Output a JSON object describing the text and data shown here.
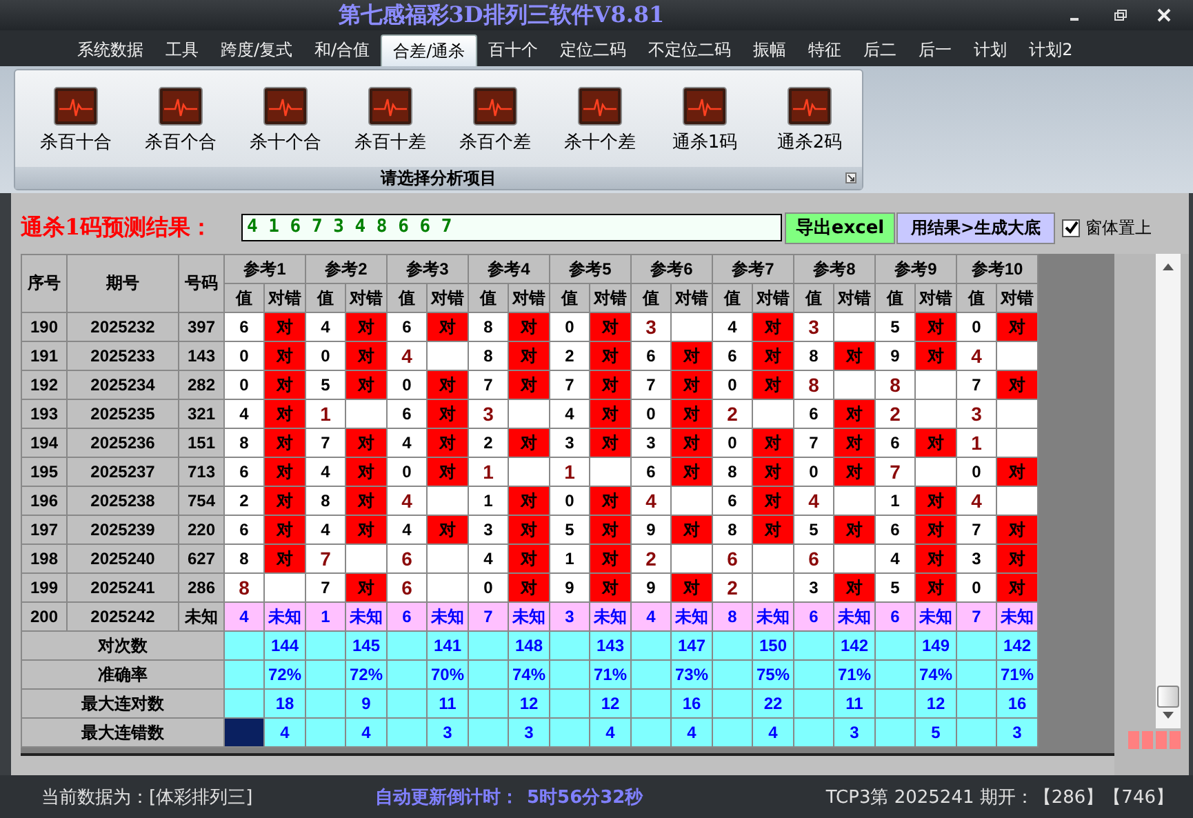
{
  "window": {
    "title": "第七感福彩3D排列三软件V8.81"
  },
  "menu_tabs": [
    {
      "label": "系统数据",
      "selected": false
    },
    {
      "label": "工具",
      "selected": false
    },
    {
      "label": "跨度/复式",
      "selected": false
    },
    {
      "label": "和/合值",
      "selected": false
    },
    {
      "label": "合差/通杀",
      "selected": true
    },
    {
      "label": "百十个",
      "selected": false
    },
    {
      "label": "定位二码",
      "selected": false
    },
    {
      "label": "不定位二码",
      "selected": false
    },
    {
      "label": "振幅",
      "selected": false
    },
    {
      "label": "特征",
      "selected": false
    },
    {
      "label": "后二",
      "selected": false
    },
    {
      "label": "后一",
      "selected": false
    },
    {
      "label": "计划",
      "selected": false
    },
    {
      "label": "计划2",
      "selected": false
    }
  ],
  "ribbon": {
    "buttons": [
      "杀百十合",
      "杀百个合",
      "杀十个合",
      "杀百十差",
      "杀百个差",
      "杀十个差",
      "通杀1码",
      "通杀2码"
    ],
    "group_caption": "请选择分析项目"
  },
  "prediction": {
    "label": "通杀1码预测结果：",
    "value": "4 1 6 7 3 4 8 6 6 7"
  },
  "export_button": "导出excel",
  "generate_button": "用结果>生成大底",
  "stay_on_top": {
    "label": "窗体置上",
    "checked": true
  },
  "table": {
    "columns": [
      "序号",
      "期号",
      "号码"
    ],
    "references": [
      {
        "title": "参考1",
        "value_header": "值",
        "result_header": "对错"
      },
      {
        "title": "参考2",
        "value_header": "值",
        "result_header": "对错"
      },
      {
        "title": "参考3",
        "value_header": "值",
        "result_header": "对错"
      },
      {
        "title": "参考4",
        "value_header": "值",
        "result_header": "对错"
      },
      {
        "title": "参考5",
        "value_header": "值",
        "result_header": "对错"
      },
      {
        "title": "参考6",
        "value_header": "值",
        "result_header": "对错"
      },
      {
        "title": "参考7",
        "value_header": "值",
        "result_header": "对错"
      },
      {
        "title": "参考8",
        "value_header": "值",
        "result_header": "对错"
      },
      {
        "title": "参考9",
        "value_header": "值",
        "result_header": "对错"
      },
      {
        "title": "参考10",
        "value_header": "值",
        "result_header": "对错"
      }
    ],
    "rows": [
      {
        "kind": "drawn",
        "index": "190",
        "period": "2025232",
        "number": "397",
        "cells": [
          {
            "value": "6",
            "hit": true,
            "result": "对"
          },
          {
            "value": "4",
            "hit": true,
            "result": "对"
          },
          {
            "value": "6",
            "hit": true,
            "result": "对"
          },
          {
            "value": "8",
            "hit": true,
            "result": "对"
          },
          {
            "value": "0",
            "hit": true,
            "result": "对"
          },
          {
            "value": "3",
            "hit": false
          },
          {
            "value": "4",
            "hit": true,
            "result": "对"
          },
          {
            "value": "3",
            "hit": false
          },
          {
            "value": "5",
            "hit": true,
            "result": "对"
          },
          {
            "value": "0",
            "hit": true,
            "result": "对"
          }
        ]
      },
      {
        "kind": "drawn",
        "index": "191",
        "period": "2025233",
        "number": "143",
        "cells": [
          {
            "value": "0",
            "hit": true,
            "result": "对"
          },
          {
            "value": "0",
            "hit": true,
            "result": "对"
          },
          {
            "value": "4",
            "hit": false
          },
          {
            "value": "8",
            "hit": true,
            "result": "对"
          },
          {
            "value": "2",
            "hit": true,
            "result": "对"
          },
          {
            "value": "6",
            "hit": true,
            "result": "对"
          },
          {
            "value": "6",
            "hit": true,
            "result": "对"
          },
          {
            "value": "8",
            "hit": true,
            "result": "对"
          },
          {
            "value": "9",
            "hit": true,
            "result": "对"
          },
          {
            "value": "4",
            "hit": false
          }
        ]
      },
      {
        "kind": "drawn",
        "index": "192",
        "period": "2025234",
        "number": "282",
        "cells": [
          {
            "value": "0",
            "hit": true,
            "result": "对"
          },
          {
            "value": "5",
            "hit": true,
            "result": "对"
          },
          {
            "value": "0",
            "hit": true,
            "result": "对"
          },
          {
            "value": "7",
            "hit": true,
            "result": "对"
          },
          {
            "value": "7",
            "hit": true,
            "result": "对"
          },
          {
            "value": "7",
            "hit": true,
            "result": "对"
          },
          {
            "value": "0",
            "hit": true,
            "result": "对"
          },
          {
            "value": "8",
            "hit": false
          },
          {
            "value": "8",
            "hit": false
          },
          {
            "value": "7",
            "hit": true,
            "result": "对"
          }
        ]
      },
      {
        "kind": "drawn",
        "index": "193",
        "period": "2025235",
        "number": "321",
        "cells": [
          {
            "value": "4",
            "hit": true,
            "result": "对"
          },
          {
            "value": "1",
            "hit": false
          },
          {
            "value": "6",
            "hit": true,
            "result": "对"
          },
          {
            "value": "3",
            "hit": false
          },
          {
            "value": "4",
            "hit": true,
            "result": "对"
          },
          {
            "value": "0",
            "hit": true,
            "result": "对"
          },
          {
            "value": "2",
            "hit": false
          },
          {
            "value": "6",
            "hit": true,
            "result": "对"
          },
          {
            "value": "2",
            "hit": false
          },
          {
            "value": "3",
            "hit": false
          }
        ]
      },
      {
        "kind": "drawn",
        "index": "194",
        "period": "2025236",
        "number": "151",
        "cells": [
          {
            "value": "8",
            "hit": true,
            "result": "对"
          },
          {
            "value": "7",
            "hit": true,
            "result": "对"
          },
          {
            "value": "4",
            "hit": true,
            "result": "对"
          },
          {
            "value": "2",
            "hit": true,
            "result": "对"
          },
          {
            "value": "3",
            "hit": true,
            "result": "对"
          },
          {
            "value": "3",
            "hit": true,
            "result": "对"
          },
          {
            "value": "0",
            "hit": true,
            "result": "对"
          },
          {
            "value": "7",
            "hit": true,
            "result": "对"
          },
          {
            "value": "6",
            "hit": true,
            "result": "对"
          },
          {
            "value": "1",
            "hit": false
          }
        ]
      },
      {
        "kind": "drawn",
        "index": "195",
        "period": "2025237",
        "number": "713",
        "cells": [
          {
            "value": "6",
            "hit": true,
            "result": "对"
          },
          {
            "value": "4",
            "hit": true,
            "result": "对"
          },
          {
            "value": "0",
            "hit": true,
            "result": "对"
          },
          {
            "value": "1",
            "hit": false
          },
          {
            "value": "1",
            "hit": false
          },
          {
            "value": "6",
            "hit": true,
            "result": "对"
          },
          {
            "value": "8",
            "hit": true,
            "result": "对"
          },
          {
            "value": "0",
            "hit": true,
            "result": "对"
          },
          {
            "value": "7",
            "hit": false
          },
          {
            "value": "0",
            "hit": true,
            "result": "对"
          }
        ]
      },
      {
        "kind": "drawn",
        "index": "196",
        "period": "2025238",
        "number": "754",
        "cells": [
          {
            "value": "2",
            "hit": true,
            "result": "对"
          },
          {
            "value": "8",
            "hit": true,
            "result": "对"
          },
          {
            "value": "4",
            "hit": false
          },
          {
            "value": "1",
            "hit": true,
            "result": "对"
          },
          {
            "value": "0",
            "hit": true,
            "result": "对"
          },
          {
            "value": "4",
            "hit": false
          },
          {
            "value": "6",
            "hit": true,
            "result": "对"
          },
          {
            "value": "4",
            "hit": false
          },
          {
            "value": "1",
            "hit": true,
            "result": "对"
          },
          {
            "value": "4",
            "hit": false
          }
        ]
      },
      {
        "kind": "drawn",
        "index": "197",
        "period": "2025239",
        "number": "220",
        "cells": [
          {
            "value": "6",
            "hit": true,
            "result": "对"
          },
          {
            "value": "4",
            "hit": true,
            "result": "对"
          },
          {
            "value": "4",
            "hit": true,
            "result": "对"
          },
          {
            "value": "3",
            "hit": true,
            "result": "对"
          },
          {
            "value": "5",
            "hit": true,
            "result": "对"
          },
          {
            "value": "9",
            "hit": true,
            "result": "对"
          },
          {
            "value": "8",
            "hit": true,
            "result": "对"
          },
          {
            "value": "5",
            "hit": true,
            "result": "对"
          },
          {
            "value": "6",
            "hit": true,
            "result": "对"
          },
          {
            "value": "7",
            "hit": true,
            "result": "对"
          }
        ]
      },
      {
        "kind": "drawn",
        "index": "198",
        "period": "2025240",
        "number": "627",
        "cells": [
          {
            "value": "8",
            "hit": true,
            "result": "对"
          },
          {
            "value": "7",
            "hit": false
          },
          {
            "value": "6",
            "hit": false
          },
          {
            "value": "4",
            "hit": true,
            "result": "对"
          },
          {
            "value": "1",
            "hit": true,
            "result": "对"
          },
          {
            "value": "2",
            "hit": false
          },
          {
            "value": "6",
            "hit": false
          },
          {
            "value": "6",
            "hit": false
          },
          {
            "value": "4",
            "hit": true,
            "result": "对"
          },
          {
            "value": "3",
            "hit": true,
            "result": "对"
          }
        ]
      },
      {
        "kind": "drawn",
        "index": "199",
        "period": "2025241",
        "number": "286",
        "cells": [
          {
            "value": "8",
            "hit": false
          },
          {
            "value": "7",
            "hit": true,
            "result": "对"
          },
          {
            "value": "6",
            "hit": false
          },
          {
            "value": "0",
            "hit": true,
            "result": "对"
          },
          {
            "value": "9",
            "hit": true,
            "result": "对"
          },
          {
            "value": "9",
            "hit": true,
            "result": "对"
          },
          {
            "value": "2",
            "hit": false
          },
          {
            "value": "3",
            "hit": true,
            "result": "对"
          },
          {
            "value": "5",
            "hit": true,
            "result": "对"
          },
          {
            "value": "0",
            "hit": true,
            "result": "对"
          }
        ]
      },
      {
        "kind": "pending",
        "index": "200",
        "period": "2025242",
        "number": "未知",
        "cells": [
          {
            "value": "4",
            "result": "未知"
          },
          {
            "value": "1",
            "result": "未知"
          },
          {
            "value": "6",
            "result": "未知"
          },
          {
            "value": "7",
            "result": "未知"
          },
          {
            "value": "3",
            "result": "未知"
          },
          {
            "value": "4",
            "result": "未知"
          },
          {
            "value": "8",
            "result": "未知"
          },
          {
            "value": "6",
            "result": "未知"
          },
          {
            "value": "6",
            "result": "未知"
          },
          {
            "value": "7",
            "result": "未知"
          }
        ]
      }
    ],
    "stats": [
      {
        "label": "对次数",
        "cells": [
          {
            "text": "144",
            "selected": false
          },
          {
            "text": "145",
            "selected": false
          },
          {
            "text": "141",
            "selected": false
          },
          {
            "text": "148",
            "selected": false
          },
          {
            "text": "143",
            "selected": false
          },
          {
            "text": "147",
            "selected": false
          },
          {
            "text": "150",
            "selected": false
          },
          {
            "text": "142",
            "selected": false
          },
          {
            "text": "149",
            "selected": false
          },
          {
            "text": "142",
            "selected": false
          }
        ]
      },
      {
        "label": "准确率",
        "cells": [
          {
            "text": "72%",
            "selected": false
          },
          {
            "text": "72%",
            "selected": false
          },
          {
            "text": "70%",
            "selected": false
          },
          {
            "text": "74%",
            "selected": false
          },
          {
            "text": "71%",
            "selected": false
          },
          {
            "text": "73%",
            "selected": false
          },
          {
            "text": "75%",
            "selected": false
          },
          {
            "text": "71%",
            "selected": false
          },
          {
            "text": "74%",
            "selected": false
          },
          {
            "text": "71%",
            "selected": false
          }
        ]
      },
      {
        "label": "最大连对数",
        "cells": [
          {
            "text": "18",
            "selected": false
          },
          {
            "text": "9",
            "selected": false
          },
          {
            "text": "11",
            "selected": false
          },
          {
            "text": "12",
            "selected": false
          },
          {
            "text": "12",
            "selected": false
          },
          {
            "text": "16",
            "selected": false
          },
          {
            "text": "22",
            "selected": false
          },
          {
            "text": "11",
            "selected": false
          },
          {
            "text": "12",
            "selected": false
          },
          {
            "text": "16",
            "selected": false
          }
        ]
      },
      {
        "label": "最大连错数",
        "cells": [
          {
            "text": "4",
            "selected": true
          },
          {
            "text": "4",
            "selected": false
          },
          {
            "text": "3",
            "selected": false
          },
          {
            "text": "3",
            "selected": false
          },
          {
            "text": "4",
            "selected": false
          },
          {
            "text": "4",
            "selected": false
          },
          {
            "text": "4",
            "selected": false
          },
          {
            "text": "3",
            "selected": false
          },
          {
            "text": "5",
            "selected": false
          },
          {
            "text": "3",
            "selected": false
          }
        ]
      }
    ]
  },
  "status_bar": {
    "data_source": "当前数据为：[体彩排列三]",
    "countdown_label": "自动更新倒计时：",
    "countdown": "5时56分32秒",
    "latest": "TCP3第 2025241 期开：【286】【746】"
  }
}
